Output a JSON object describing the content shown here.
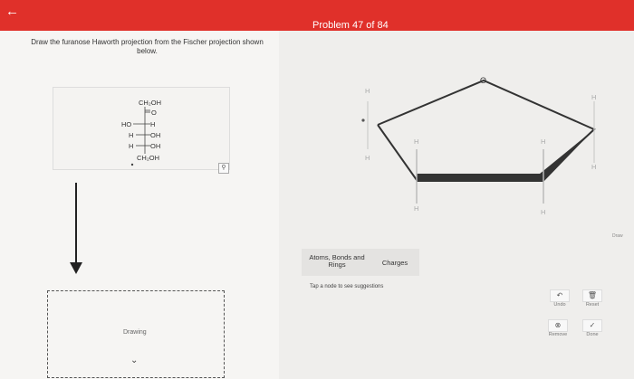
{
  "header": {
    "back_icon": "back-arrow-icon",
    "problem_counter": "Problem 47 of 84",
    "accent_color": "#e0302a"
  },
  "question": {
    "instructions": "Draw the furanose Haworth projection from the Fischer projection shown below."
  },
  "fischer": {
    "top": "CH₂OH",
    "carbonyl": "O",
    "rows": [
      {
        "left": "HO",
        "right": "H"
      },
      {
        "left": "H",
        "right": "OH"
      },
      {
        "left": "H",
        "right": "OH"
      }
    ],
    "bottom": "CH₂OH"
  },
  "haworth": {
    "ring_oxygen": "O",
    "h_labels": [
      "H",
      "H",
      "H",
      "H",
      "H",
      "H",
      "H",
      "H"
    ]
  },
  "drawing_area": {
    "label": "Drawing"
  },
  "toolbar": {
    "tab_atoms": "Atoms, Bonds and Rings",
    "tab_charges": "Charges",
    "hint": "Tap a node to see suggestions"
  },
  "controls": {
    "undo": "Undo",
    "reset": "Reset",
    "remove": "Remove",
    "done": "Done"
  },
  "side_tag": "Draw"
}
